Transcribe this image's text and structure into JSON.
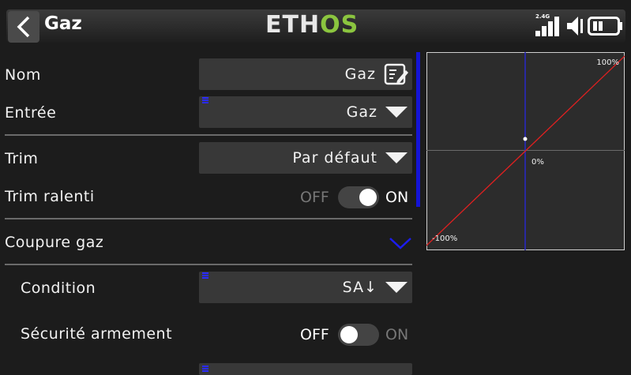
{
  "header": {
    "title": "Gaz",
    "logo_part1": "ETH",
    "logo_part2": "OS",
    "radio_band": "2.4G"
  },
  "form": {
    "nom": {
      "label": "Nom",
      "value": "Gaz"
    },
    "entree": {
      "label": "Entrée",
      "value": "Gaz"
    },
    "trim": {
      "label": "Trim",
      "value": "Par défaut"
    },
    "trim_ralenti": {
      "label": "Trim ralenti",
      "off": "OFF",
      "on": "ON",
      "state": "on"
    },
    "coupure_gaz": {
      "label": "Coupure gaz"
    },
    "condition": {
      "label": "Condition",
      "value": "SA↓"
    },
    "securite": {
      "label": "Sécurité armement",
      "off": "OFF",
      "on": "ON",
      "state": "off"
    }
  },
  "curve": {
    "label_max": "100%",
    "label_mid": "0%",
    "label_min": "-100%",
    "colors": {
      "line": "#e02020",
      "axis": "#2828c8",
      "grid": "#6a6a6a",
      "bg": "#2c2c2c"
    }
  },
  "colors": {
    "accent": "#1414d6",
    "logo_green": "#8bc53f"
  }
}
